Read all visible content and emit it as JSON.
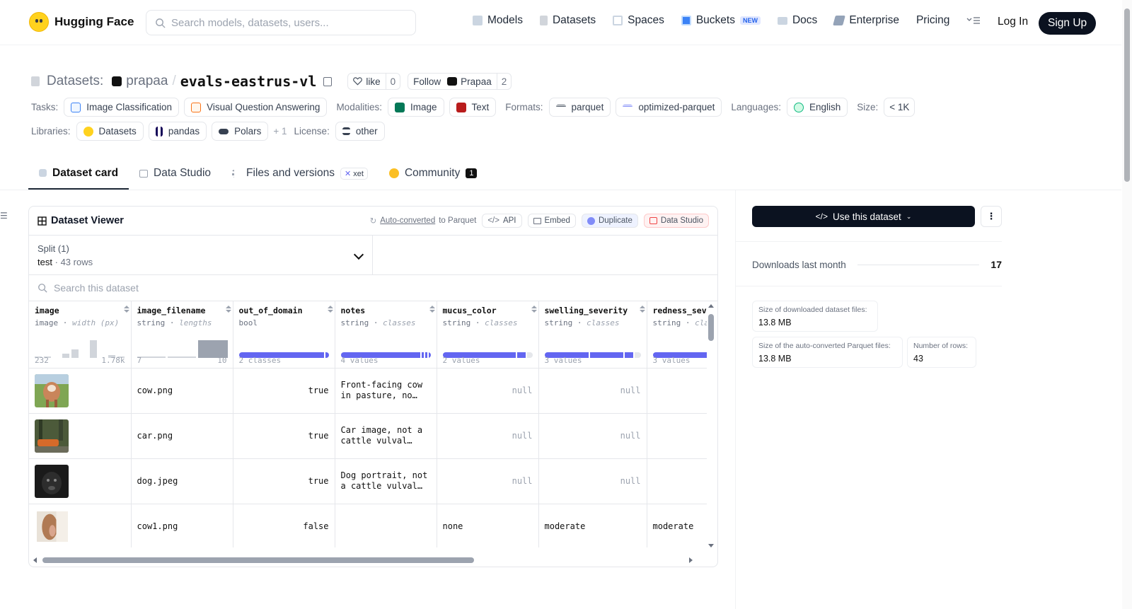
{
  "header": {
    "brand": "Hugging Face",
    "search_placeholder": "Search models, datasets, users...",
    "nav": [
      {
        "label": "Models",
        "icon": "cube-icon"
      },
      {
        "label": "Datasets",
        "icon": "database-icon"
      },
      {
        "label": "Spaces",
        "icon": "grid-icon"
      },
      {
        "label": "Buckets",
        "icon": "bucket-icon",
        "badge": "NEW"
      },
      {
        "label": "Docs",
        "icon": "book-icon"
      },
      {
        "label": "Enterprise",
        "icon": "enterprise-icon"
      },
      {
        "label": "Pricing"
      }
    ],
    "login": "Log In",
    "signup": "Sign Up"
  },
  "repo": {
    "section": "Datasets:",
    "owner": "prapaa",
    "slash": "/",
    "name": "evals-eastrus-vl",
    "like_label": "like",
    "like_count": "0",
    "follow_label": "Follow",
    "follow_name": "Prapaa",
    "follow_count": "2"
  },
  "tags": {
    "tasks_label": "Tasks:",
    "tasks": [
      "Image Classification",
      "Visual Question Answering"
    ],
    "modalities_label": "Modalities:",
    "modalities": [
      "Image",
      "Text"
    ],
    "formats_label": "Formats:",
    "formats": [
      "parquet",
      "optimized-parquet"
    ],
    "languages_label": "Languages:",
    "languages": [
      "English"
    ],
    "size_label": "Size:",
    "size": "< 1K",
    "libraries_label": "Libraries:",
    "libraries": [
      "Datasets",
      "pandas",
      "Polars"
    ],
    "libraries_more": "+ 1",
    "license_label": "License:",
    "license": "other"
  },
  "tabs": [
    {
      "label": "Dataset card",
      "active": true
    },
    {
      "label": "Data Studio"
    },
    {
      "label": "Files and versions",
      "badge": "xet"
    },
    {
      "label": "Community",
      "count": "1"
    }
  ],
  "viewer": {
    "title": "Dataset Viewer",
    "autoconv_link": "Auto-converted",
    "autoconv_rest": "to Parquet",
    "api": "API",
    "embed": "Embed",
    "duplicate": "Duplicate",
    "studio": "Data Studio",
    "split_label": "Split (1)",
    "split_value": "test",
    "split_rows": "43 rows",
    "search_placeholder": "Search this dataset",
    "columns": [
      {
        "name": "image",
        "type": "image",
        "stat": "width (px)",
        "min": "232",
        "max": "1.78k"
      },
      {
        "name": "image_filename",
        "type": "string",
        "stat": "lengths",
        "min": "7",
        "max": "10"
      },
      {
        "name": "out_of_domain",
        "type": "bool",
        "stat": "",
        "summary": "2 classes"
      },
      {
        "name": "notes",
        "type": "string",
        "stat": "classes",
        "summary": "4 values"
      },
      {
        "name": "mucus_color",
        "type": "string",
        "stat": "classes",
        "summary": "2 values"
      },
      {
        "name": "swelling_severity",
        "type": "string",
        "stat": "classes",
        "summary": "3 values"
      },
      {
        "name": "redness_sev",
        "type": "string",
        "stat": "cla",
        "summary": "3 values"
      }
    ],
    "rows": [
      {
        "file": "cow.png",
        "ood": "true",
        "notes": "Front-facing cow in pasture, no…",
        "mucus": "null",
        "swell": "null",
        "red": ""
      },
      {
        "file": "car.png",
        "ood": "true",
        "notes": "Car image, not a cattle vulval…",
        "mucus": "null",
        "swell": "null",
        "red": ""
      },
      {
        "file": "dog.jpeg",
        "ood": "true",
        "notes": "Dog portrait, not a cattle vulval…",
        "mucus": "null",
        "swell": "null",
        "red": ""
      },
      {
        "file": "cow1.png",
        "ood": "false",
        "notes": "",
        "mucus": "none",
        "swell": "moderate",
        "red": "moderate"
      }
    ]
  },
  "sidebar": {
    "use_button": "Use this dataset",
    "downloads_label": "Downloads last month",
    "downloads": "17",
    "dl_size_label": "Size of downloaded dataset files:",
    "dl_size": "13.8 MB",
    "pq_size_label": "Size of the auto-converted Parquet files:",
    "pq_size": "13.8 MB",
    "rows_label": "Number of rows:",
    "rows": "43"
  },
  "colors": {
    "accent": "#6366f1",
    "dark": "#0b1220",
    "brand": "#ffd21e"
  }
}
